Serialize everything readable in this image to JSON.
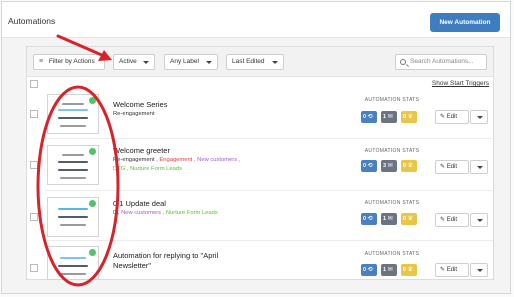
{
  "header": {
    "title": "Automations",
    "new_button": "New Automation"
  },
  "filters": {
    "filter_by_actions": "Filter by Actions",
    "status": "Active",
    "label": "Any Label",
    "sort": "Last Edited",
    "search_placeholder": "Search Automations...",
    "show_start_triggers": "Show Start Triggers"
  },
  "colors": {
    "primary": "#3f7dc1",
    "stat_blue": "#4a7fc0",
    "stat_gray": "#6b7480",
    "stat_yellow": "#e9c64a",
    "annotation_red": "#d8232a",
    "tag_red": "#e03b3b",
    "tag_purple": "#a259d9",
    "tag_green": "#5bbd39"
  },
  "stats_label": "AUTOMATION STATS",
  "edit_label": "Edit",
  "automations": [
    {
      "title": "Welcome Series",
      "subtitle": "Re-engagement",
      "stats": [
        "0",
        "1",
        "0"
      ]
    },
    {
      "title": "Welcome greeter",
      "tags_line1": [
        "Re-engagement ,",
        "Engagement ,",
        "New customers ,"
      ],
      "tags_line2": [
        "DTG ,",
        "Nurture Form Leads"
      ],
      "stats": [
        "0",
        "3",
        "0"
      ]
    },
    {
      "title": "0.1 Update deal",
      "tags_line1": [
        "0 ,",
        "New customers ,",
        "Nurture Form Leads"
      ],
      "stats": [
        "0",
        "1",
        "0"
      ]
    },
    {
      "title": "Automation for replying to \"April",
      "title_line2": "Newsletter\"",
      "stats": [
        "0",
        "1",
        "0"
      ]
    }
  ]
}
